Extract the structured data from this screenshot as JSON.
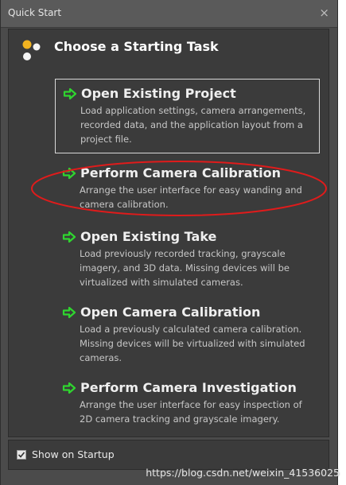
{
  "window": {
    "title": "Quick Start",
    "close_symbol": "×"
  },
  "header": {
    "title": "Choose a Starting Task",
    "icon": "dots-cluster-icon"
  },
  "tasks": [
    {
      "title": "Open Existing Project",
      "description": "Load application settings, camera arrangements, recorded data, and the application layout from a project file.",
      "selected": true
    },
    {
      "title": "Perform Camera Calibration",
      "description": "Arrange the user interface for easy wanding and camera calibration.",
      "highlighted": true
    },
    {
      "title": "Open Existing Take",
      "description": "Load previously recorded tracking, grayscale imagery, and 3D data.  Missing devices will be virtualized with simulated cameras."
    },
    {
      "title": "Open Camera Calibration",
      "description": "Load a previously calculated camera calibration. Missing devices will be virtualized with simulated cameras."
    },
    {
      "title": "Perform Camera Investigation",
      "description": "Arrange the user interface for easy inspection of 2D camera tracking and grayscale imagery."
    }
  ],
  "footer": {
    "checkbox_label": "Show on Startup",
    "checked": true
  },
  "watermark": "https://blog.csdn.net/weixin_41536025",
  "colors": {
    "arrow_green": "#2fd52f",
    "annotation_red": "#e01b1b",
    "background": "#3b3b3b"
  }
}
